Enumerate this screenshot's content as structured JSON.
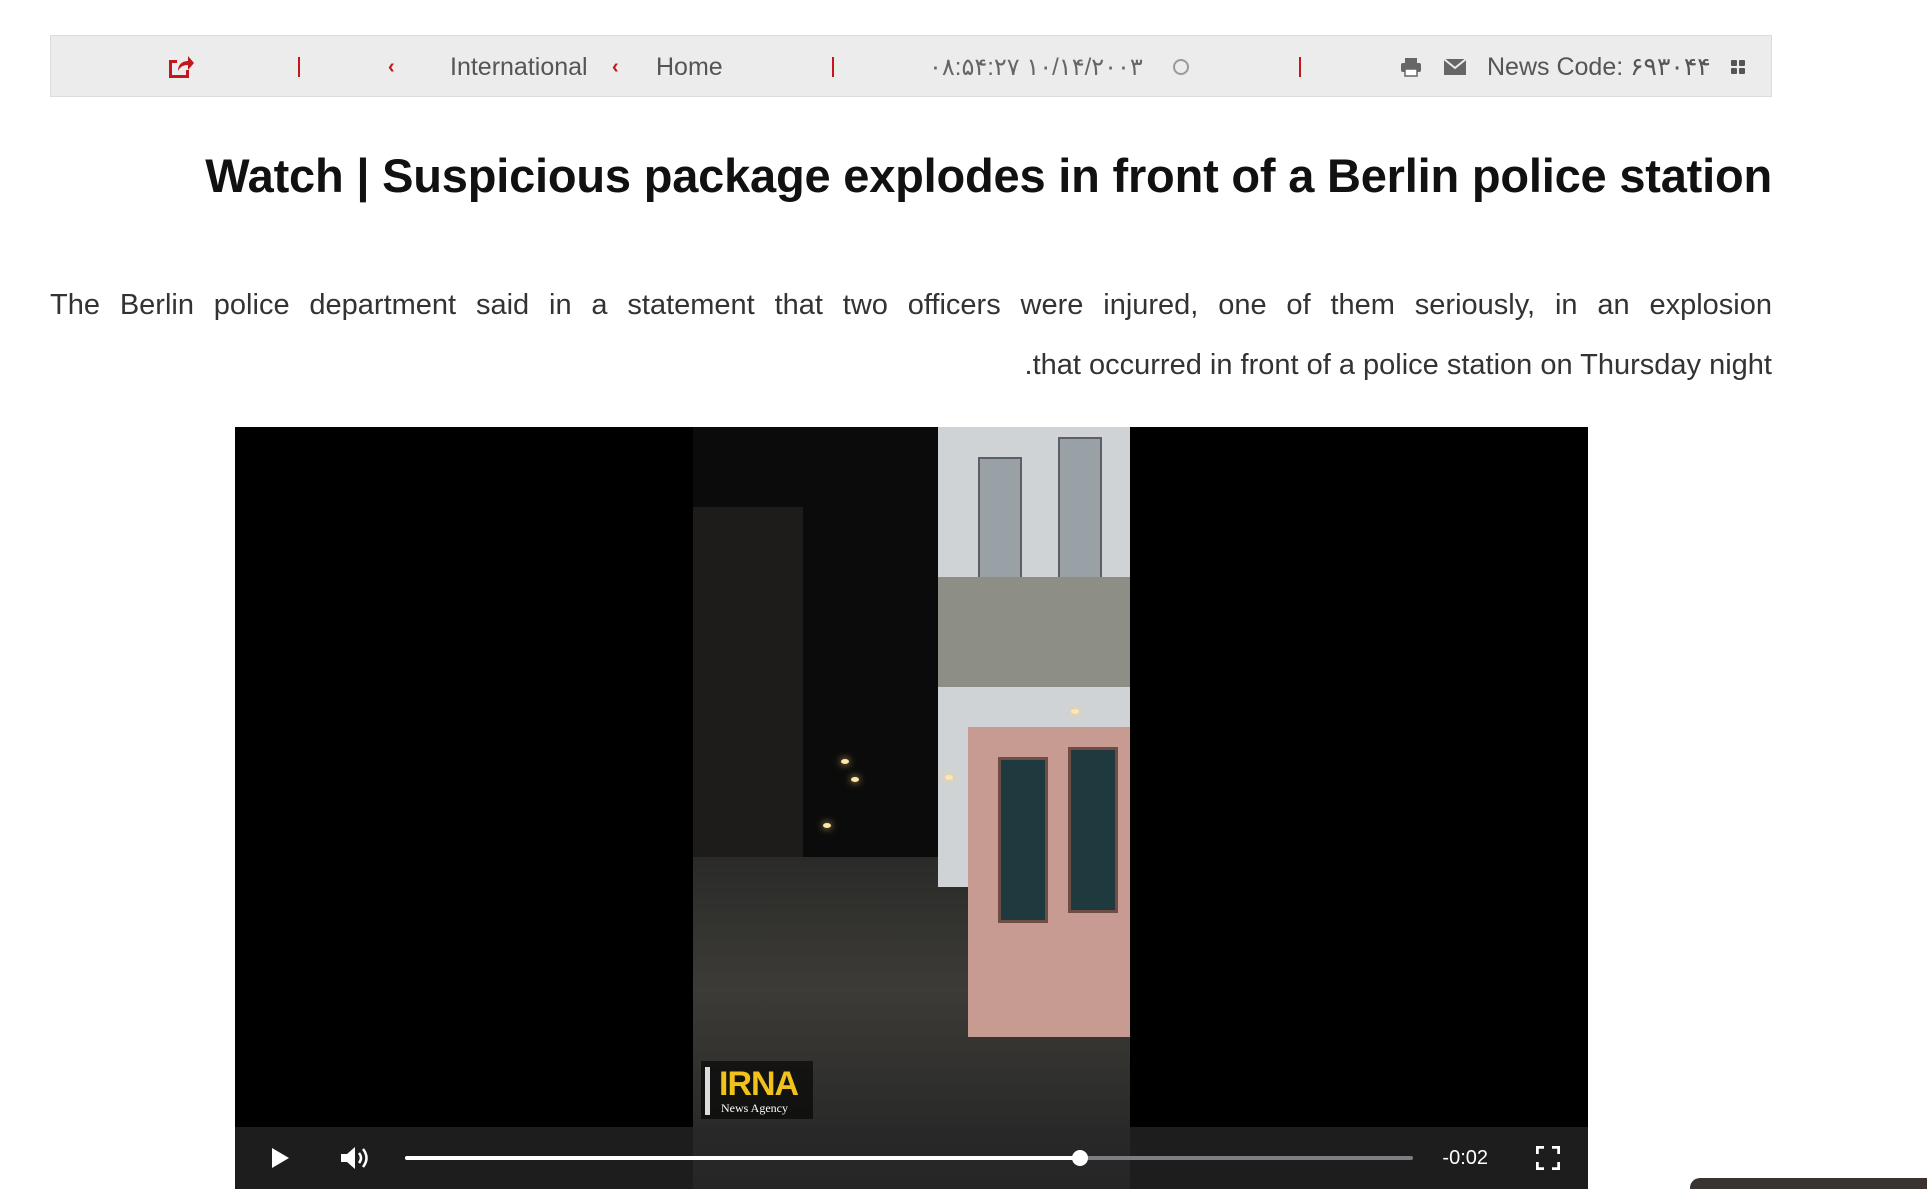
{
  "topbar": {
    "crumbs": [
      {
        "label": "International"
      },
      {
        "label": "Home"
      }
    ],
    "datetime": "۰۸:۵۴:۲۷ ۱۰/۱۴/۲۰۰۳",
    "news_code": "News Code: ۶۹۳۰۴۴",
    "icons": [
      "share-icon",
      "chevron-left-icon",
      "clock-icon",
      "print-icon",
      "email-icon",
      "grid-icon"
    ],
    "accent_color": "#c4161c"
  },
  "article": {
    "title": "Watch | Suspicious package explodes in front of a Berlin police station",
    "lead_line1": "The Berlin police department said in a statement that two officers were injured, one of them seriously, in an explosion",
    "lead_line2": ".that occurred in front of a police station on Thursday night"
  },
  "video": {
    "watermark_main": "IRNA",
    "watermark_sub": "News Agency",
    "time_remaining": "-0:02",
    "progress": 0.67,
    "icons": [
      "play-icon",
      "volume-icon",
      "fullscreen-icon"
    ]
  }
}
